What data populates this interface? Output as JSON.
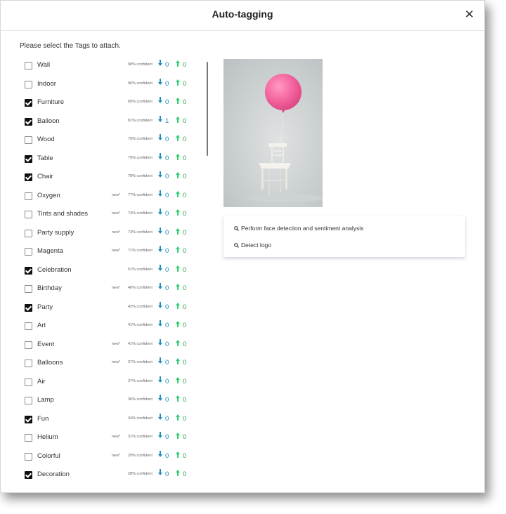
{
  "dialog": {
    "title": "Auto-tagging",
    "close_glyph": "✕",
    "instruction": "Please select the Tags to attach."
  },
  "colors": {
    "down_arrow": "#1a8fc1",
    "up_arrow": "#2ecc71",
    "checkbox_checked": "#111111"
  },
  "tags": [
    {
      "name": "Wall",
      "checked": false,
      "new": "",
      "confidence": "98% confident",
      "down": "0",
      "up": "0"
    },
    {
      "name": "Indoor",
      "checked": false,
      "new": "",
      "confidence": "96% confident",
      "down": "0",
      "up": "0"
    },
    {
      "name": "Furniture",
      "checked": true,
      "new": "",
      "confidence": "89% confident",
      "down": "0",
      "up": "0"
    },
    {
      "name": "Balloon",
      "checked": true,
      "new": "",
      "confidence": "81% confident",
      "down": "1",
      "up": "0"
    },
    {
      "name": "Wood",
      "checked": false,
      "new": "",
      "confidence": "79% confident",
      "down": "0",
      "up": "0"
    },
    {
      "name": "Table",
      "checked": true,
      "new": "",
      "confidence": "79% confident",
      "down": "0",
      "up": "0"
    },
    {
      "name": "Chair",
      "checked": true,
      "new": "",
      "confidence": "78% confident",
      "down": "0",
      "up": "0"
    },
    {
      "name": "Oxygen",
      "checked": false,
      "new": "new*",
      "confidence": "77% confident",
      "down": "0",
      "up": "0"
    },
    {
      "name": "Tints and shades",
      "checked": false,
      "new": "new*",
      "confidence": "74% confident",
      "down": "0",
      "up": "0"
    },
    {
      "name": "Party supply",
      "checked": false,
      "new": "new*",
      "confidence": "73% confident",
      "down": "0",
      "up": "0"
    },
    {
      "name": "Magenta",
      "checked": false,
      "new": "new*",
      "confidence": "71% confident",
      "down": "0",
      "up": "0"
    },
    {
      "name": "Celebration",
      "checked": true,
      "new": "",
      "confidence": "51% confident",
      "down": "0",
      "up": "0"
    },
    {
      "name": "Birthday",
      "checked": false,
      "new": "new*",
      "confidence": "48% confident",
      "down": "0",
      "up": "0"
    },
    {
      "name": "Party",
      "checked": true,
      "new": "",
      "confidence": "42% confident",
      "down": "0",
      "up": "0"
    },
    {
      "name": "Art",
      "checked": false,
      "new": "",
      "confidence": "41% confident",
      "down": "0",
      "up": "0"
    },
    {
      "name": "Event",
      "checked": false,
      "new": "new*",
      "confidence": "41% confident",
      "down": "0",
      "up": "0"
    },
    {
      "name": "Balloons",
      "checked": false,
      "new": "new*",
      "confidence": "37% confident",
      "down": "0",
      "up": "0"
    },
    {
      "name": "Air",
      "checked": false,
      "new": "",
      "confidence": "37% confident",
      "down": "0",
      "up": "0"
    },
    {
      "name": "Lamp",
      "checked": false,
      "new": "",
      "confidence": "36% confident",
      "down": "0",
      "up": "0"
    },
    {
      "name": "Fun",
      "checked": true,
      "new": "",
      "confidence": "34% confident",
      "down": "0",
      "up": "0"
    },
    {
      "name": "Helium",
      "checked": false,
      "new": "new*",
      "confidence": "31% confident",
      "down": "0",
      "up": "0"
    },
    {
      "name": "Colorful",
      "checked": false,
      "new": "new*",
      "confidence": "29% confident",
      "down": "0",
      "up": "0"
    },
    {
      "name": "Decoration",
      "checked": true,
      "new": "",
      "confidence": "28% confident",
      "down": "0",
      "up": "0"
    }
  ],
  "actions": [
    {
      "label": "Perform face detection and sentiment analysis",
      "icon": "search-icon"
    },
    {
      "label": "Detect logo",
      "icon": "search-icon"
    }
  ],
  "image": {
    "subject": "pink-balloon-on-white-chair"
  }
}
